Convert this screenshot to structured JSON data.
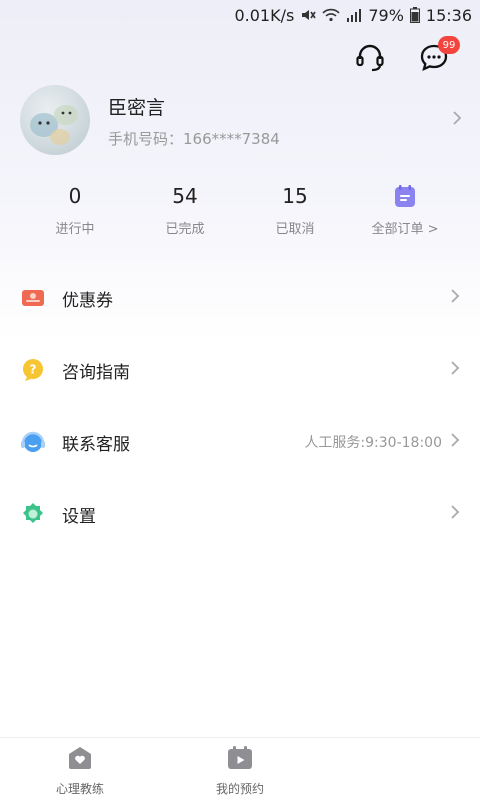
{
  "status_bar": {
    "speed": "0.01K/s",
    "battery": "79%",
    "time": "15:36"
  },
  "header": {
    "message_badge": "99"
  },
  "profile": {
    "name": "臣密言",
    "phone": "手机号码：166****7384"
  },
  "stats": [
    {
      "value": "0",
      "label": "进行中"
    },
    {
      "value": "54",
      "label": "已完成"
    },
    {
      "value": "15",
      "label": "已取消"
    }
  ],
  "all_orders_label": "全部订单 >",
  "menu": [
    {
      "label": "优惠券",
      "extra": "",
      "icon": "coupon-icon"
    },
    {
      "label": "咨询指南",
      "extra": "",
      "icon": "guide-icon"
    },
    {
      "label": "联系客服",
      "extra": "人工服务:9:30-18:00",
      "icon": "customer-service-icon"
    },
    {
      "label": "设置",
      "extra": "",
      "icon": "settings-icon"
    }
  ],
  "bottom_nav": [
    {
      "label": "心理教练",
      "icon": "heart-house-icon"
    },
    {
      "label": "我的预约",
      "icon": "calendar-play-icon"
    }
  ]
}
